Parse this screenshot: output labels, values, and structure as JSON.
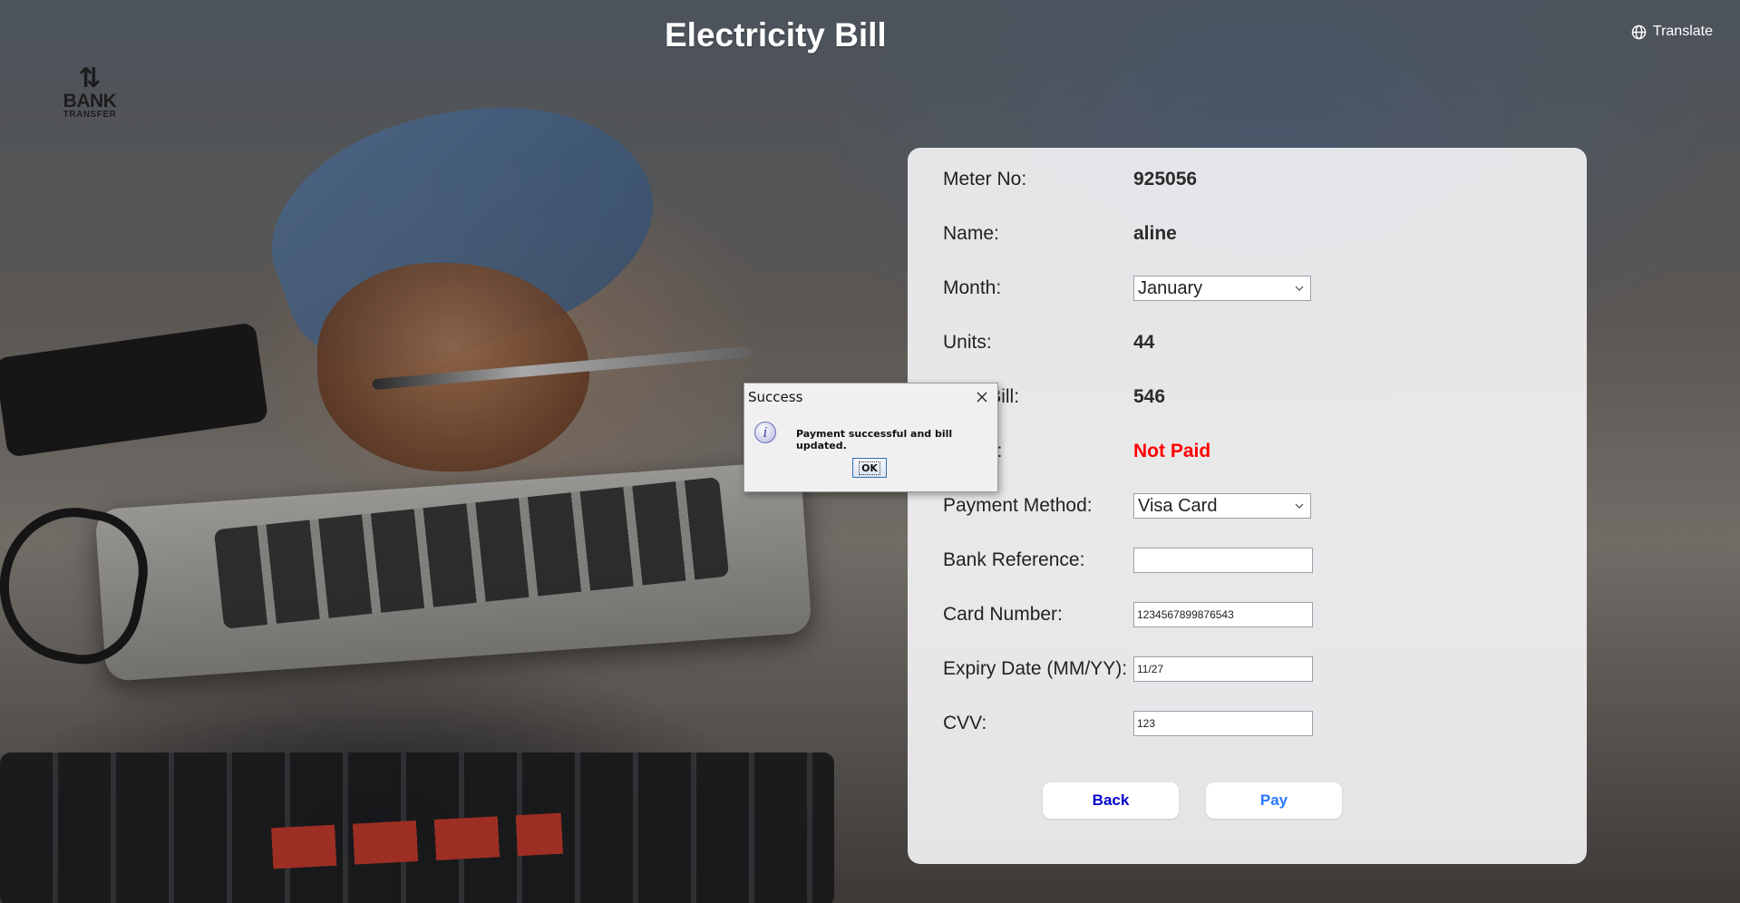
{
  "app": {
    "title": "Electricity Bill",
    "logo": {
      "line1": "BANK",
      "line2": "TRANSFER"
    },
    "translate_label": "Translate"
  },
  "form": {
    "meter_no": {
      "label": "Meter No:",
      "value": "925056"
    },
    "name": {
      "label": "Name:",
      "value": "aline"
    },
    "month": {
      "label": "Month:",
      "selected": "January"
    },
    "units": {
      "label": "Units:",
      "value": "44"
    },
    "total_bill": {
      "label": "Total Bill:",
      "value": "546"
    },
    "status": {
      "label": "Status:",
      "value": "Not Paid",
      "color": "#ff0000"
    },
    "payment_method": {
      "label": "Payment Method:",
      "selected": "Visa Card"
    },
    "bank_reference": {
      "label": "Bank Reference:",
      "value": ""
    },
    "card_number": {
      "label": "Card Number:",
      "value": "1234567899876543"
    },
    "expiry_date": {
      "label": "Expiry Date (MM/YY):",
      "value": "11/27"
    },
    "cvv": {
      "label": "CVV:",
      "value": "123"
    },
    "buttons": {
      "back": "Back",
      "pay": "Pay"
    }
  },
  "dialog": {
    "title": "Success",
    "message": "Payment successful and bill updated.",
    "ok_label": "OK",
    "icon": "info-icon"
  },
  "colors": {
    "title_text": "#ffffff",
    "status_unpaid": "#ff0000",
    "back_button_text": "#0000cc",
    "pay_button_text": "#2979ff"
  }
}
